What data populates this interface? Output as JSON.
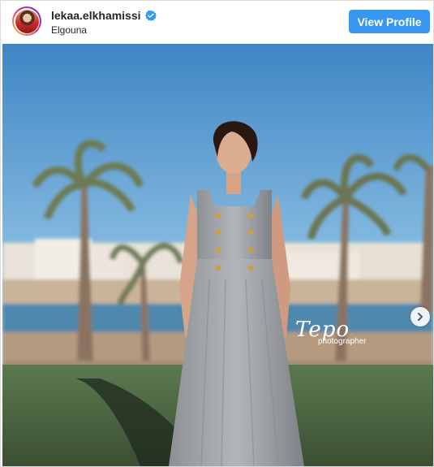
{
  "post": {
    "username": "lekaa.elkhamissi",
    "location": "Elgouna",
    "view_profile_label": "View Profile",
    "verified": true
  },
  "watermark": {
    "main": "Tepo",
    "sub": "photographer"
  },
  "icons": {
    "verified": "verified-badge-icon",
    "next": "chevron-right-icon"
  },
  "colors": {
    "button": "#3897f0",
    "verified": "#3897f0",
    "text": "#262626"
  }
}
